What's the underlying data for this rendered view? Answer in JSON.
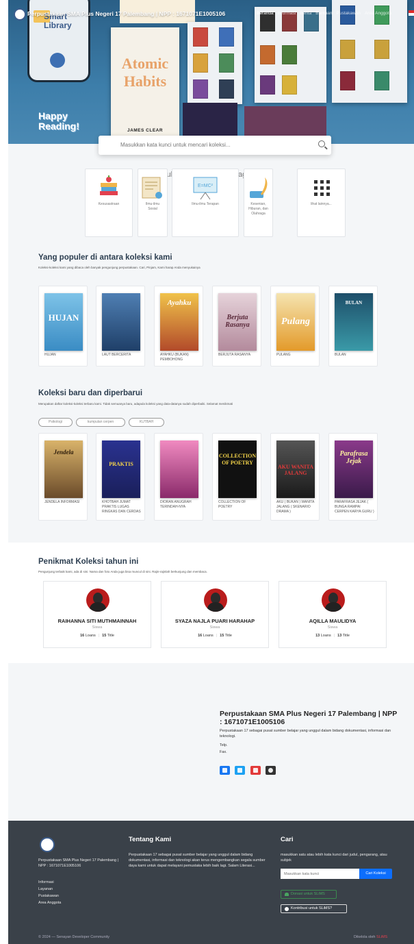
{
  "nav": {
    "title": "Perpustakaan SMA Plus Negeri 17 Palembang | NPP : 1671071E1005106",
    "links": [
      "Beranda",
      "Informasi",
      "Berita",
      "Bantuan",
      "Pustakawan",
      "Area Anggota"
    ]
  },
  "hero": {
    "phone_title": "Smart Library",
    "happy": "Happy Reading!",
    "atomic_title": "Atomic Habits",
    "atomic_author": "JAMES CLEAR"
  },
  "search": {
    "placeholder": "Masukkan kata kunci untuk mencari koleksi..."
  },
  "subjects": {
    "heading": "Pilih subjek yang menarik bagi Anda",
    "items": [
      {
        "label": "Kesusastraan"
      },
      {
        "label": "Ilmu-ilmu Sosial"
      },
      {
        "label": "Ilmu-ilmu Terapan"
      },
      {
        "label": "Kesenian, Hiburan, dan Olahraga"
      },
      {
        "label": "lihat lainnya..."
      }
    ]
  },
  "popular": {
    "title": "Yang populer di antara koleksi kami",
    "subtitle": "Koleksi-koleksi kami yang dibaca oleh banyak pengunjung perpustakaan. Cari, Pinjam, Kami harap Anda menyukainya",
    "books": [
      {
        "title": "HUJAN",
        "cover": "HUJAN",
        "color": "#5aa8d6"
      },
      {
        "title": "LAUT BERCERITA",
        "cover": "",
        "color": "#2f5f8f"
      },
      {
        "title": "AYAHKU (BUKAN) PEMBOHONG",
        "cover": "Ayahku",
        "color": "#d98a2b"
      },
      {
        "title": "BERJUTA RASANYA",
        "cover": "Berjuta Rasanya",
        "color": "#c9a7b4"
      },
      {
        "title": "PULANG",
        "cover": "Pulang",
        "color": "#e8a735"
      },
      {
        "title": "BULAN",
        "cover": "BULAN",
        "color": "#2a6f8c"
      }
    ]
  },
  "newest": {
    "title": "Koleksi baru dan diperbarui",
    "subtitle": "Merupakan daftar koleksi-koleksi terbaru kami. Tidak semuanya baru, adapula koleksi yang data-datanya sudah diperbaiki. Selamat menikmati",
    "pills": [
      "Psikologi",
      "kumpulan cerpen",
      "KUTBAH"
    ],
    "books": [
      {
        "title": "JENDELA INFORMASI",
        "cover": "Jendela",
        "color": "#8a6f3a"
      },
      {
        "title": "KHOTBAH JUMAT PRAKTIS LUGAS RINGKAS DAN CERDAS",
        "cover": "PRAKTIS",
        "color": "#2c2f7a"
      },
      {
        "title": "DIORAN ANUGRAH TERINDAH-NYA",
        "cover": "",
        "color": "#c2468a"
      },
      {
        "title": "COLLECTION OF POETRY",
        "cover": "COLLECTION OF POETRY",
        "color": "#111111"
      },
      {
        "title": "AKU ( BUKAN ) WANITA JALANG ( SKENARIO DRAMA )",
        "cover": "AKU WANITA JALANG",
        "color": "#2a2a2a"
      },
      {
        "title": "PARAFRASA JEJAK ( BUNGA RAMPAI CERPEN KARYA GURU )",
        "cover": "Parafrasa Jejak",
        "color": "#6a2a6a"
      }
    ]
  },
  "readers": {
    "title": "Penikmat Koleksi tahun ini",
    "subtitle": "Pengunjung terbaik kami, ada di sini. Nama dan foto Anda juga bisa muncul di sini. Rajin-rajinlah berkunjung dan membaca.",
    "items": [
      {
        "name": "RAIHANNA SITI MUTHMAINNAH",
        "role": "Siswa",
        "loans": "16",
        "titles": "15"
      },
      {
        "name": "SYAZA NAJLA PUARI HARAHAP",
        "role": "Siswa",
        "loans": "16",
        "titles": "15"
      },
      {
        "name": "AQILLA MAULIDYA",
        "role": "Siswa",
        "loans": "13",
        "titles": "13"
      }
    ],
    "loans_label": "Loans",
    "title_label": "Title"
  },
  "about": {
    "title": "Perpustakaan SMA Plus Negeri 17 Palembang | NPP : 1671071E1005106",
    "desc": "Perpustakaan 17 sebagai pusat sumber belajar yang unggul dalam bidang dokumentasi, informasi dan teknologi.",
    "telp": "Telp.",
    "fax": "Fax."
  },
  "footer": {
    "org": "Perpustakaan SMA Plus Negeri 17 Palembang | NPP : 1671071E1005106",
    "links": [
      "Informasi",
      "Layanan",
      "Pustakawan",
      "Area Anggota"
    ],
    "about_title": "Tentang Kami",
    "about_text": "Perpustakaan 17 sebagai pusat sumber belajar yang unggul dalam bidang dokumentasi, informasi dan teknologi akan terus mengembangkan segala sumber daya kami untuk dapat melayani pemustaka lebih baik lagi. Salam Literasi...",
    "search_title": "Cari",
    "search_text": "masukkan satu atau lebih kata kunci dari judul, pengarang, atau subjek",
    "search_placeholder": "Masukkan kata kunci",
    "search_button": "Cari Koleksi",
    "donate": "Donasi untuk SLiMS",
    "contribute": "Kontribusi untuk SLiMS?",
    "copyright": "© 2024 — Senayan Developer Community",
    "powered_prefix": "Dikelola oleh",
    "powered_name": "SLiMS"
  },
  "colors": {
    "primary": "#0d6efd",
    "footer_bg": "#3a4149",
    "heading": "#2c3e50",
    "accent_red": "#e2404f"
  }
}
